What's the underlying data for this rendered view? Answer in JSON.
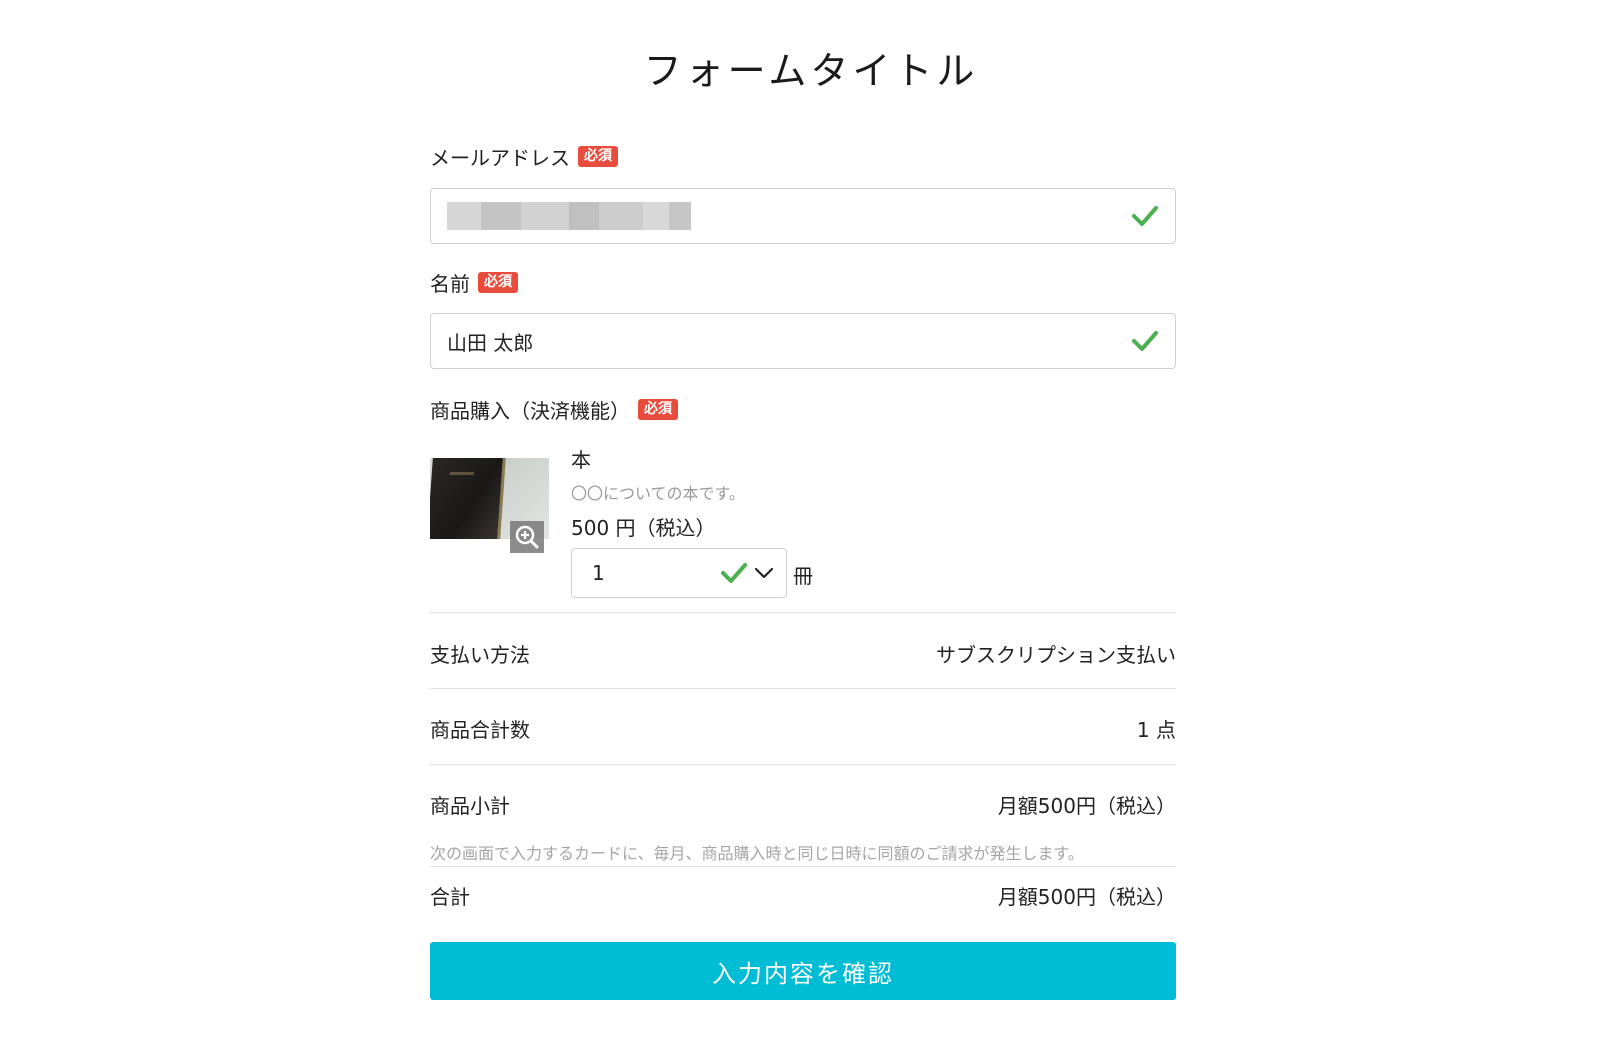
{
  "form": {
    "title": "フォームタイトル"
  },
  "email": {
    "label": "メールアドレス",
    "required_badge": "必須",
    "status_icon": "check-icon"
  },
  "name": {
    "label": "名前",
    "required_badge": "必須",
    "value": "山田 太郎",
    "status_icon": "check-icon"
  },
  "purchase": {
    "label": "商品購入（決済機能）",
    "required_badge": "必須",
    "product": {
      "name": "本",
      "description": "〇〇についての本です。",
      "price": "500 円（税込）",
      "quantity": "1",
      "unit": "冊"
    }
  },
  "summary": {
    "payment_method_label": "支払い方法",
    "payment_method_value": "サブスクリプション支払い",
    "total_items_label": "商品合計数",
    "total_items_value": "1 点",
    "subtotal_label": "商品小計",
    "subtotal_value": "月額500円（税込）",
    "subtotal_note": "次の画面で入力するカードに、毎月、商品購入時と同じ日時に同額のご請求が発生します。",
    "total_label": "合計",
    "total_value": "月額500円（税込）"
  },
  "actions": {
    "confirm_label": "入力内容を確認"
  },
  "colors": {
    "accent": "#00bcd4",
    "required": "#e74c3c",
    "valid": "#4caf50"
  }
}
